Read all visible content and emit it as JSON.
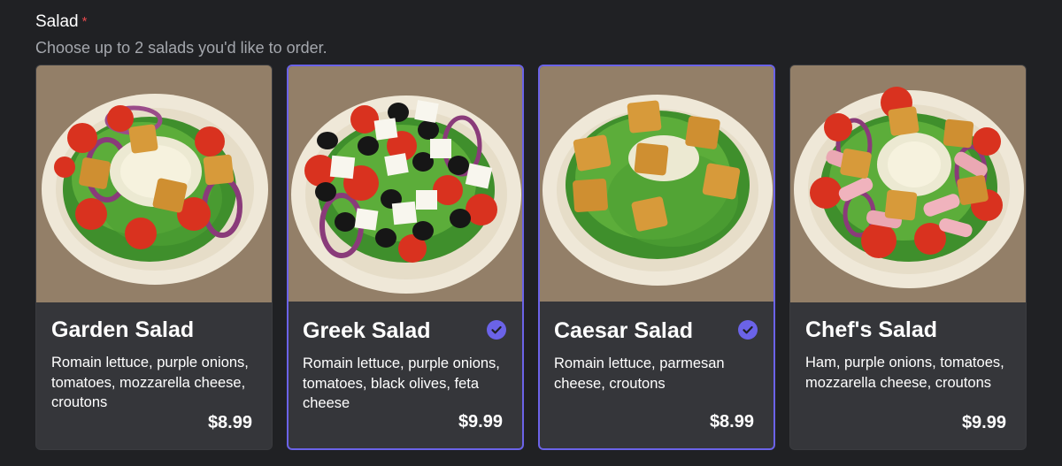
{
  "field": {
    "label": "Salad",
    "required_mark": "*",
    "hint": "Choose up to 2 salads you'd like to order."
  },
  "colors": {
    "background": "#202124",
    "card": "#35363a",
    "accent": "#6b63e8",
    "required": "#e5484d"
  },
  "salads": [
    {
      "name": "Garden Salad",
      "description": "Romain lettuce, purple onions, tomatoes, mozzarella cheese, croutons",
      "price": "$8.99",
      "selected": false,
      "image": "garden-salad-photo"
    },
    {
      "name": "Greek Salad",
      "description": "Romain lettuce, purple onions, tomatoes, black olives, feta cheese",
      "price": "$9.99",
      "selected": true,
      "image": "greek-salad-photo"
    },
    {
      "name": "Caesar Salad",
      "description": "Romain lettuce, parmesan cheese, croutons",
      "price": "$8.99",
      "selected": true,
      "image": "caesar-salad-photo"
    },
    {
      "name": "Chef's Salad",
      "description": "Ham, purple onions, tomatoes, mozzarella cheese, croutons",
      "price": "$9.99",
      "selected": false,
      "image": "chefs-salad-photo"
    }
  ]
}
